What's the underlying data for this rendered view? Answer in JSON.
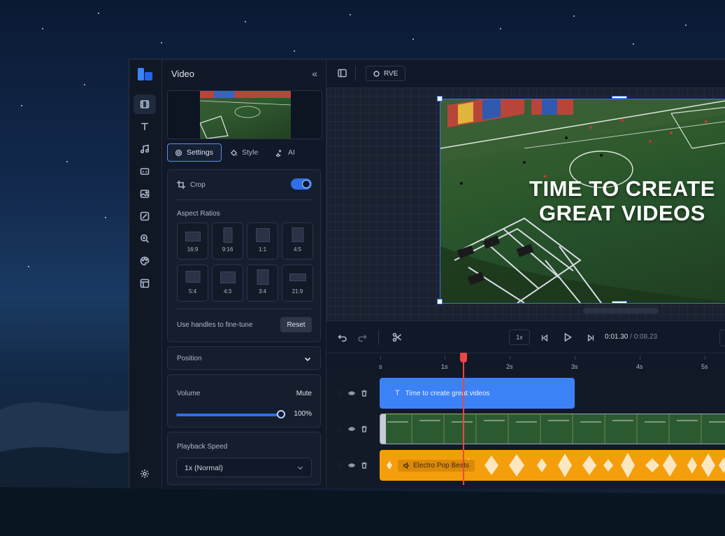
{
  "panel": {
    "title": "Video",
    "collapse_icon": "«"
  },
  "rail": {
    "items": [
      "video-icon",
      "text-icon",
      "music-icon",
      "captions-icon",
      "image-icon",
      "sticker-icon",
      "zoom-icon",
      "palette-icon",
      "template-icon"
    ],
    "bottom": "settings-icon"
  },
  "tabs": [
    {
      "label": "Settings",
      "icon": "gear-icon",
      "active": true
    },
    {
      "label": "Style",
      "icon": "paint-bucket-icon",
      "active": false
    },
    {
      "label": "AI",
      "icon": "sparkles-icon",
      "active": false
    }
  ],
  "crop": {
    "label": "Crop",
    "enabled": true,
    "aspect_title": "Aspect Ratios",
    "ratios": [
      "16:9",
      "9:16",
      "1:1",
      "4:5",
      "5:4",
      "4:3",
      "3:4",
      "21:9"
    ],
    "fine_tune": "Use handles to fine-tune",
    "reset": "Reset"
  },
  "position": {
    "label": "Position"
  },
  "volume": {
    "label": "Volume",
    "mute": "Mute",
    "value": "100%",
    "level": 1.0
  },
  "playback": {
    "label": "Playback Speed",
    "value": "1x (Normal)"
  },
  "topbar": {
    "project": "RVE"
  },
  "preview": {
    "caption_line1": "TIME TO CREATE",
    "caption_line2": "GREAT VIDEOS"
  },
  "controls": {
    "speed": "1x",
    "current_time": "0:01.30",
    "separator": "/",
    "total_time": "0:08.23"
  },
  "ruler": {
    "ticks": [
      "s",
      "1s",
      "2s",
      "3s",
      "4s",
      "5s"
    ]
  },
  "tracks": {
    "text_clip": "Time to create great videos",
    "audio_clip": "Electro Pop Beats"
  },
  "colors": {
    "accent": "#2f6fe8",
    "text_clip": "#3b82f6",
    "audio_clip": "#f59e0b",
    "playhead": "#ef4444"
  }
}
